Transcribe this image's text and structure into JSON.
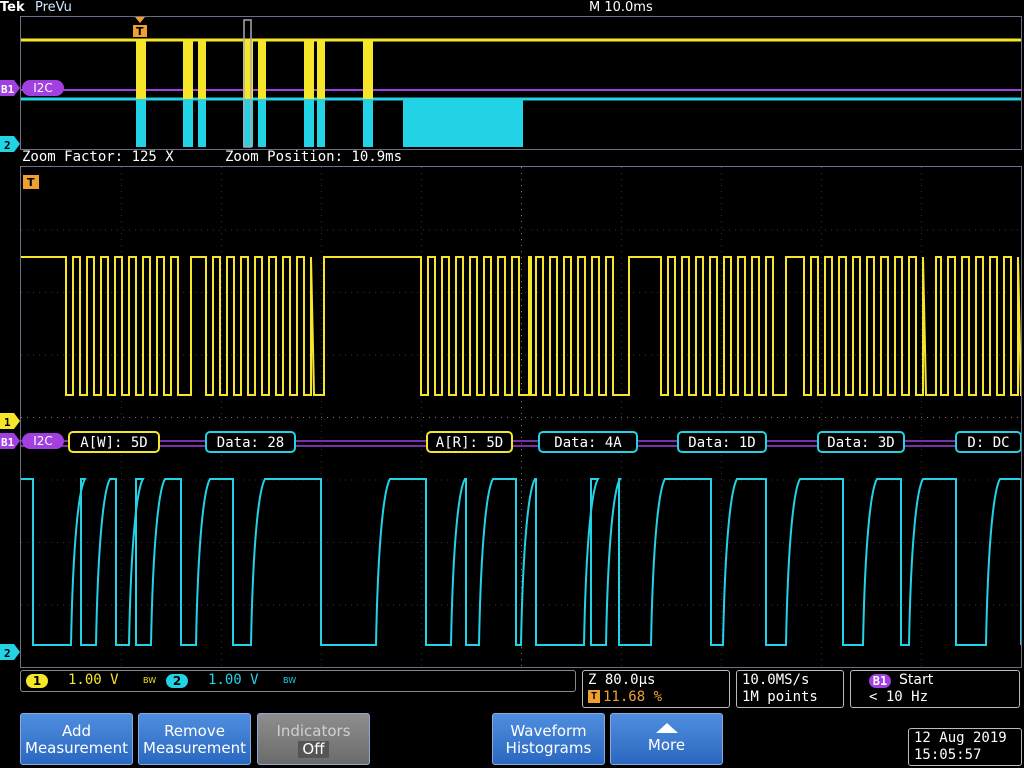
{
  "header": {
    "brand": "Tek",
    "mode": "PreVu",
    "timebase": "M 10.0ms"
  },
  "zoom": {
    "factor_label": "Zoom Factor: 125 X",
    "position_label": "Zoom Position: 10.9ms"
  },
  "markers": {
    "trigger": "T",
    "ch1": "1",
    "ch2": "2",
    "bus": "B1",
    "bus_name": "I2C"
  },
  "decode_packets": [
    {
      "label": "A[W]: 5D",
      "kind": "address"
    },
    {
      "label": "Data: 28",
      "kind": "data"
    },
    {
      "label": "A[R]: 5D",
      "kind": "address"
    },
    {
      "label": "Data: 4A",
      "kind": "data"
    },
    {
      "label": "Data: 1D",
      "kind": "data"
    },
    {
      "label": "Data: 3D",
      "kind": "data"
    },
    {
      "label": "D: DC",
      "kind": "data"
    }
  ],
  "channels": {
    "ch1": {
      "chip": "1",
      "scale": "1.00 V",
      "bw": "BW",
      "color": "#f5e62a"
    },
    "ch2": {
      "chip": "2",
      "scale": "1.00 V",
      "bw": "BW",
      "color": "#22d3e6"
    }
  },
  "horizontal": {
    "z_scale": "Z 80.0µs",
    "trigger_pos": "11.68 %",
    "sample_rate": "10.0MS/s",
    "record_length": "1M points"
  },
  "trigger": {
    "bus_chip": "B1",
    "condition": "Start",
    "frequency": "< 10 Hz"
  },
  "buttons": {
    "add_line1": "Add",
    "add_line2": "Measurement",
    "remove_line1": "Remove",
    "remove_line2": "Measurement",
    "indicators_line1": "Indicators",
    "indicators_line2": "Off",
    "histo_line1": "Waveform",
    "histo_line2": "Histograms",
    "more": "More"
  },
  "datetime": {
    "date": "12 Aug 2019",
    "time": "15:05:57"
  },
  "colors": {
    "ch1": "#f5e62a",
    "ch2": "#22d3e6",
    "bus": "#a23fe0",
    "trigger": "#f0a030",
    "address_box": "#f5e62a",
    "data_box": "#22d3e6"
  }
}
